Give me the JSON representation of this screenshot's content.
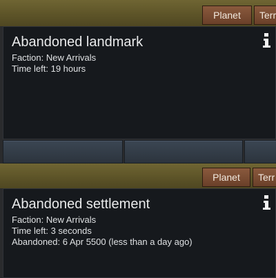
{
  "cards": [
    {
      "tabs": [
        "Planet",
        "Terr"
      ],
      "title": "Abandoned landmark",
      "lines": [
        "Faction: New Arrivals",
        "Time left: 19 hours"
      ]
    },
    {
      "tabs": [
        "Planet",
        "Terr"
      ],
      "title": "Abandoned settlement",
      "lines": [
        "Faction: New Arrivals",
        "Time left: 3 seconds",
        "Abandoned: 6 Apr 5500 (less than a day ago)"
      ]
    }
  ],
  "icons": {
    "info": "info-icon"
  }
}
